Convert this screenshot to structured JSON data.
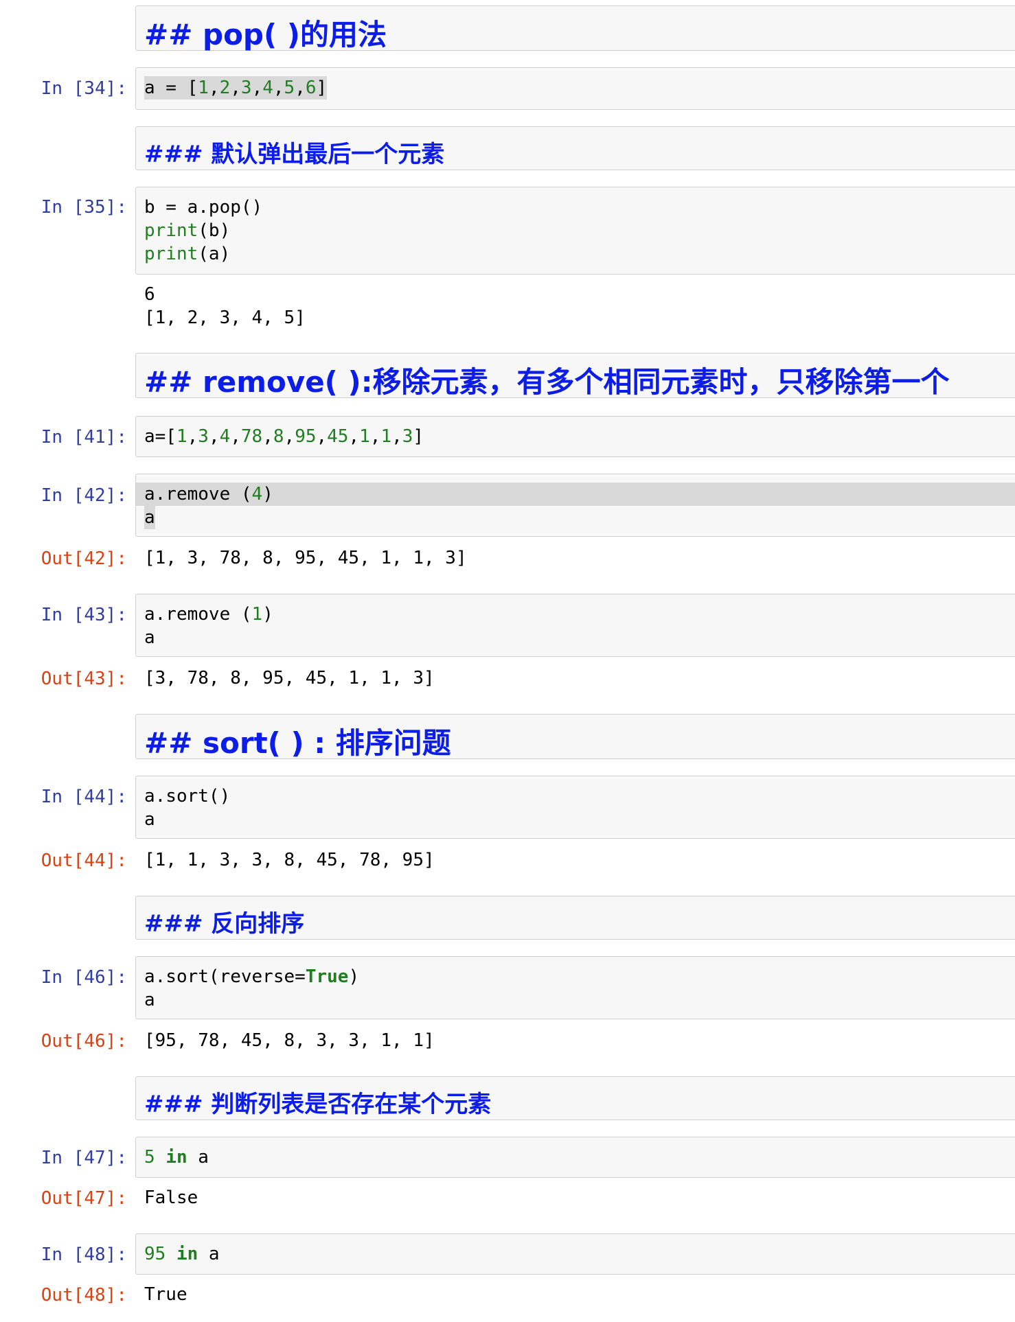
{
  "cells": {
    "h_pop": "## pop( )的用法",
    "c34": {
      "prompt": "In [34]:",
      "code": [
        "a = [",
        "1",
        ",",
        "2",
        ",",
        "3",
        ",",
        "4",
        ",",
        "5",
        ",",
        "6",
        "]"
      ]
    },
    "h_default": "### 默认弹出最后一个元素",
    "c35": {
      "prompt": "In [35]:",
      "line1": "b = a.pop()",
      "kw": "print",
      "arg2": "(b)",
      "arg3": "(a)",
      "out1": "6",
      "out2": "[1, 2, 3, 4, 5]"
    },
    "h_remove": "## remove( ):移除元素，有多个相同元素时，只移除第一个",
    "c41": {
      "prompt": "In [41]:",
      "code": [
        "a=[",
        "1",
        ",",
        "3",
        ",",
        "4",
        ",",
        "78",
        ",",
        "8",
        ",",
        "95",
        ",",
        "45",
        ",",
        "1",
        ",",
        "1",
        ",",
        "3",
        "]"
      ]
    },
    "c42": {
      "prompt": "In [42]:",
      "pre": "a.remove (",
      "num": "4",
      "post": ")",
      "line2": "a",
      "out_prompt": "Out[42]:",
      "out": "[1, 3, 78, 8, 95, 45, 1, 1, 3]"
    },
    "c43": {
      "prompt": "In [43]:",
      "pre": "a.remove (",
      "num": "1",
      "post": ")",
      "line2": "a",
      "out_prompt": "Out[43]:",
      "out": "[3, 78, 8, 95, 45, 1, 1, 3]"
    },
    "h_sort": "## sort( ) : 排序问题",
    "c44": {
      "prompt": "In [44]:",
      "line1": "a.sort()",
      "line2": "a",
      "out_prompt": "Out[44]:",
      "out": "[1, 1, 3, 3, 8, 45, 78, 95]"
    },
    "h_reverse": "### 反向排序",
    "c46": {
      "prompt": "In [46]:",
      "pre": "a.sort(reverse=",
      "kw": "True",
      "post": ")",
      "line2": "a",
      "out_prompt": "Out[46]:",
      "out": "[95, 78, 45, 8, 3, 3, 1, 1]"
    },
    "h_in": "### 判断列表是否存在某个元素",
    "c47": {
      "prompt": "In [47]:",
      "num": "5",
      "kw": "in",
      "var": " a",
      "out_prompt": "Out[47]:",
      "out": "False"
    },
    "c48": {
      "prompt": "In [48]:",
      "num": "95",
      "kw": "in",
      "var": " a",
      "out_prompt": "Out[48]:",
      "out": "True"
    }
  }
}
